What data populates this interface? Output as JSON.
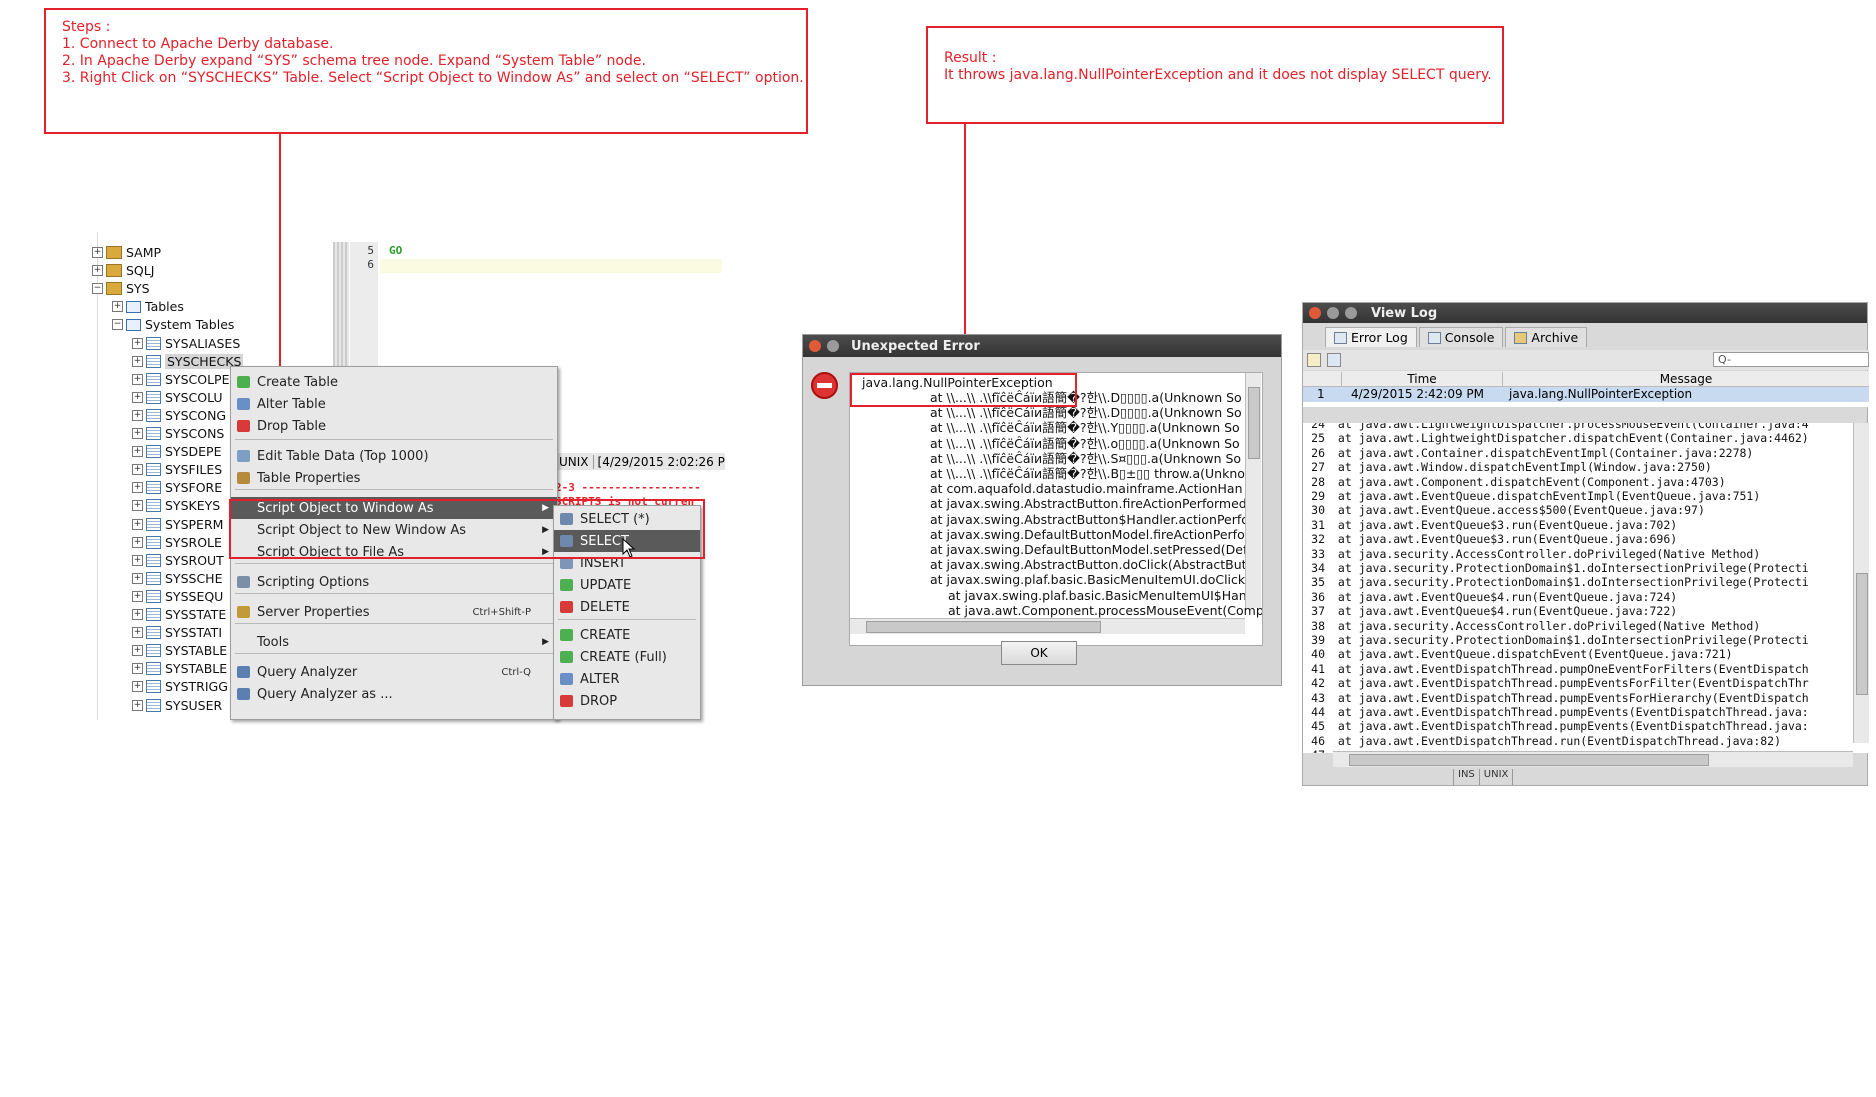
{
  "steps_note": {
    "heading": "Steps :",
    "lines": [
      "1. Connect to Apache Derby database.",
      "2. In Apache Derby expand “SYS” schema tree node. Expand “System Table” node.",
      "3. Right Click on “SYSCHECKS” Table. Select “Script Object to Window As” and select on “SELECT” option."
    ]
  },
  "result_note": {
    "heading": "Result :",
    "line": "It throws java.lang.NullPointerException and it does not display SELECT query."
  },
  "tree": {
    "items": [
      {
        "label": "SAMP",
        "level": 0,
        "icon": "database-icon",
        "expanded": false
      },
      {
        "label": "SQLJ",
        "level": 0,
        "icon": "database-icon",
        "expanded": false
      },
      {
        "label": "SYS",
        "level": 0,
        "icon": "database-icon",
        "expanded": true
      },
      {
        "label": "Tables",
        "level": 1,
        "icon": "folder-icon",
        "expanded": false
      },
      {
        "label": "System Tables",
        "level": 1,
        "icon": "folder-icon",
        "expanded": true
      },
      {
        "label": "SYSALIASES",
        "level": 2,
        "icon": "table-icon"
      },
      {
        "label": "SYSCHECKS",
        "level": 2,
        "icon": "table-icon",
        "selected": true
      },
      {
        "label": "SYSCOLPE",
        "level": 2,
        "icon": "table-icon"
      },
      {
        "label": "SYSCOLU",
        "level": 2,
        "icon": "table-icon"
      },
      {
        "label": "SYSCONG",
        "level": 2,
        "icon": "table-icon"
      },
      {
        "label": "SYSCONS",
        "level": 2,
        "icon": "table-icon"
      },
      {
        "label": "SYSDEPE",
        "level": 2,
        "icon": "table-icon"
      },
      {
        "label": "SYSFILES",
        "level": 2,
        "icon": "table-icon"
      },
      {
        "label": "SYSFORE",
        "level": 2,
        "icon": "table-icon"
      },
      {
        "label": "SYSKEYS",
        "level": 2,
        "icon": "table-icon"
      },
      {
        "label": "SYSPERM",
        "level": 2,
        "icon": "table-icon"
      },
      {
        "label": "SYSROLE",
        "level": 2,
        "icon": "table-icon"
      },
      {
        "label": "SYSROUT",
        "level": 2,
        "icon": "table-icon"
      },
      {
        "label": "SYSSCHE",
        "level": 2,
        "icon": "table-icon"
      },
      {
        "label": "SYSSEQU",
        "level": 2,
        "icon": "table-icon"
      },
      {
        "label": "SYSSTATE",
        "level": 2,
        "icon": "table-icon"
      },
      {
        "label": "SYSSTATI",
        "level": 2,
        "icon": "table-icon"
      },
      {
        "label": "SYSTABLE",
        "level": 2,
        "icon": "table-icon"
      },
      {
        "label": "SYSTABLE",
        "level": 2,
        "icon": "table-icon"
      },
      {
        "label": "SYSTRIGG",
        "level": 2,
        "icon": "table-icon"
      },
      {
        "label": "SYSUSER",
        "level": 2,
        "icon": "table-icon"
      }
    ]
  },
  "editor": {
    "line_numbers": [
      "5",
      "6"
    ],
    "code_line": "GO",
    "status_unix": "UNIX",
    "status_time": "[4/29/2015 2:02:26 P",
    "output_line1": "2-3 ------------------",
    "output_line2": "SCRIPTS is not curren"
  },
  "context_menu": {
    "items": [
      {
        "label": "Create Table",
        "icon": "create-table-icon"
      },
      {
        "label": "Alter Table",
        "icon": "alter-table-icon"
      },
      {
        "label": "Drop Table",
        "icon": "drop-table-icon"
      },
      {
        "label": "Edit Table Data (Top 1000)",
        "icon": "edit-data-icon"
      },
      {
        "label": "Table Properties",
        "icon": "properties-icon"
      },
      {
        "label": "Script Object to Window As",
        "submenu": true,
        "selected": true
      },
      {
        "label": "Script Object to New Window As",
        "submenu": true
      },
      {
        "label": "Script Object to File As",
        "submenu": true
      },
      {
        "label": "Scripting Options",
        "icon": "scripting-icon"
      },
      {
        "label": "Server Properties",
        "icon": "server-icon",
        "shortcut": "Ctrl+Shift-P"
      },
      {
        "label": "Tools",
        "submenu": true
      },
      {
        "label": "Query Analyzer",
        "icon": "query-icon",
        "shortcut": "Ctrl-Q"
      },
      {
        "label": "Query Analyzer as ...",
        "icon": "query-as-icon"
      }
    ]
  },
  "submenu": {
    "items": [
      {
        "label": "SELECT (*)",
        "icon": "select-all-icon"
      },
      {
        "label": "SELECT",
        "icon": "select-icon",
        "selected": true
      },
      {
        "label": "INSERT",
        "icon": "insert-icon"
      },
      {
        "label": "UPDATE",
        "icon": "update-icon"
      },
      {
        "label": "DELETE",
        "icon": "delete-icon"
      },
      {
        "label": "CREATE",
        "icon": "create-icon"
      },
      {
        "label": "CREATE (Full)",
        "icon": "create-full-icon"
      },
      {
        "label": "ALTER",
        "icon": "alter-icon"
      },
      {
        "label": "DROP",
        "icon": "drop-icon"
      }
    ]
  },
  "error_dialog": {
    "title": "Unexpected Error",
    "exception": "java.lang.NullPointerException",
    "stack": [
      "at \\\\...\\\\ .\\\\fĩĉëĈáïи語簡�?한\\\\.D▯▯▯▯.a(Unknown So",
      "at \\\\...\\\\ .\\\\fĩĉëĈáïи語簡�?한\\\\.D▯▯▯▯.a(Unknown So",
      "at \\\\...\\\\ .\\\\fĩĉëĈáïи語簡�?한\\\\.Y▯▯▯▯.a(Unknown So",
      "at \\\\...\\\\ .\\\\fĩĉëĈáïи語簡�?한\\\\.o▯▯▯▯.a(Unknown So",
      "at \\\\...\\\\ .\\\\fĩĉëĈáïи語簡�?한\\\\.S¤▯▯▯.a(Unknown So",
      "at \\\\...\\\\ .\\\\fĩĉëĈáïи語簡�?한\\\\.B▯±▯▯ throw.a(Unkno",
      "at com.aquafold.datastudio.mainframe.ActionHan",
      "at javax.swing.AbstractButton.fireActionPerformed",
      "at javax.swing.AbstractButton$Handler.actionPerfo",
      "at javax.swing.DefaultButtonModel.fireActionPerfo",
      "at javax.swing.DefaultButtonModel.setPressed(Def",
      "at javax.swing.AbstractButton.doClick(AbstractBut",
      "at javax.swing.plaf.basic.BasicMenuItemUI.doClick(",
      "at javax.swing.plaf.basic.BasicMenuItemUI$Han",
      "at java.awt.Component.processMouseEvent(Comp"
    ],
    "ok_label": "OK"
  },
  "view_log": {
    "title": "View Log",
    "tabs": [
      {
        "label": "Error Log",
        "icon": "error-log-icon",
        "active": true
      },
      {
        "label": "Console",
        "icon": "console-icon"
      },
      {
        "label": "Archive",
        "icon": "archive-icon"
      }
    ],
    "search_placeholder": "Q-",
    "columns": [
      "Time",
      "Message"
    ],
    "rows": [
      {
        "num": "1",
        "time": "4/29/2015 2:42:09 PM",
        "message": "java.lang.NullPointerException"
      }
    ],
    "log_lines": [
      {
        "n": "24",
        "text": "    at java.awt.LightweightDispatcher.processMouseEvent(Container.java:4"
      },
      {
        "n": "25",
        "text": "    at java.awt.LightweightDispatcher.dispatchEvent(Container.java:4462)"
      },
      {
        "n": "26",
        "text": "    at java.awt.Container.dispatchEventImpl(Container.java:2278)"
      },
      {
        "n": "27",
        "text": "    at java.awt.Window.dispatchEventImpl(Window.java:2750)"
      },
      {
        "n": "28",
        "text": "    at java.awt.Component.dispatchEvent(Component.java:4703)"
      },
      {
        "n": "29",
        "text": "    at java.awt.EventQueue.dispatchEventImpl(EventQueue.java:751)"
      },
      {
        "n": "30",
        "text": "    at java.awt.EventQueue.access$500(EventQueue.java:97)"
      },
      {
        "n": "31",
        "text": "    at java.awt.EventQueue$3.run(EventQueue.java:702)"
      },
      {
        "n": "32",
        "text": "    at java.awt.EventQueue$3.run(EventQueue.java:696)"
      },
      {
        "n": "33",
        "text": "    at java.security.AccessController.doPrivileged(Native Method)"
      },
      {
        "n": "34",
        "text": "    at java.security.ProtectionDomain$1.doIntersectionPrivilege(Protecti"
      },
      {
        "n": "35",
        "text": "    at java.security.ProtectionDomain$1.doIntersectionPrivilege(Protecti"
      },
      {
        "n": "36",
        "text": "    at java.awt.EventQueue$4.run(EventQueue.java:724)"
      },
      {
        "n": "37",
        "text": "    at java.awt.EventQueue$4.run(EventQueue.java:722)"
      },
      {
        "n": "38",
        "text": "    at java.security.AccessController.doPrivileged(Native Method)"
      },
      {
        "n": "39",
        "text": "    at java.security.ProtectionDomain$1.doIntersectionPrivilege(Protecti"
      },
      {
        "n": "40",
        "text": "    at java.awt.EventQueue.dispatchEvent(EventQueue.java:721)"
      },
      {
        "n": "41",
        "text": "    at java.awt.EventDispatchThread.pumpOneEventForFilters(EventDispatch"
      },
      {
        "n": "42",
        "text": "    at java.awt.EventDispatchThread.pumpEventsForFilter(EventDispatchThr"
      },
      {
        "n": "43",
        "text": "    at java.awt.EventDispatchThread.pumpEventsForHierarchy(EventDispatch"
      },
      {
        "n": "44",
        "text": "    at java.awt.EventDispatchThread.pumpEvents(EventDispatchThread.java:"
      },
      {
        "n": "45",
        "text": "    at java.awt.EventDispatchThread.pumpEvents(EventDispatchThread.java:"
      },
      {
        "n": "46",
        "text": "    at java.awt.EventDispatchThread.run(EventDispatchThread.java:82)"
      },
      {
        "n": "47",
        "text": ""
      }
    ],
    "status_ins": "INS",
    "status_unix": "UNIX"
  },
  "colors": {
    "annotation": "#e3212b",
    "menu_selected": "#5a5a5a",
    "titlebar": "#3c3c3c",
    "row_selected": "#c8daf0"
  }
}
